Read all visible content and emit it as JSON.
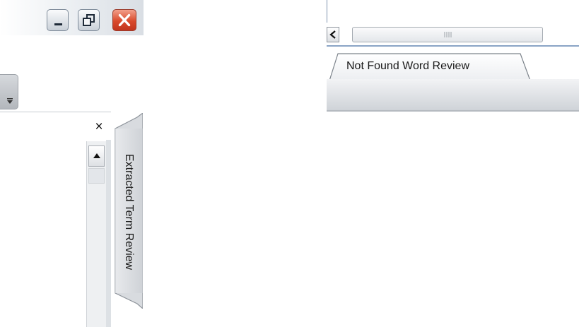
{
  "window_controls": {
    "minimize_icon": "minimize-icon",
    "restore_icon": "restore-icon",
    "close_icon": "close-icon"
  },
  "panel": {
    "overflow_icon": "chevron-down-icon",
    "close_label": "×"
  },
  "side_tab": {
    "label": "Extracted Term Review"
  },
  "horizontal_scrollbar": {
    "left_arrow_icon": "chevron-left-icon",
    "grip_icon": "grip-icon"
  },
  "bottom_tabs": {
    "active_tab_label": "Not Found Word Review"
  },
  "colors": {
    "close_red": "#d94a2c",
    "accent_blue": "#8aa4c6",
    "chrome_gray": "#cfd3d8"
  }
}
